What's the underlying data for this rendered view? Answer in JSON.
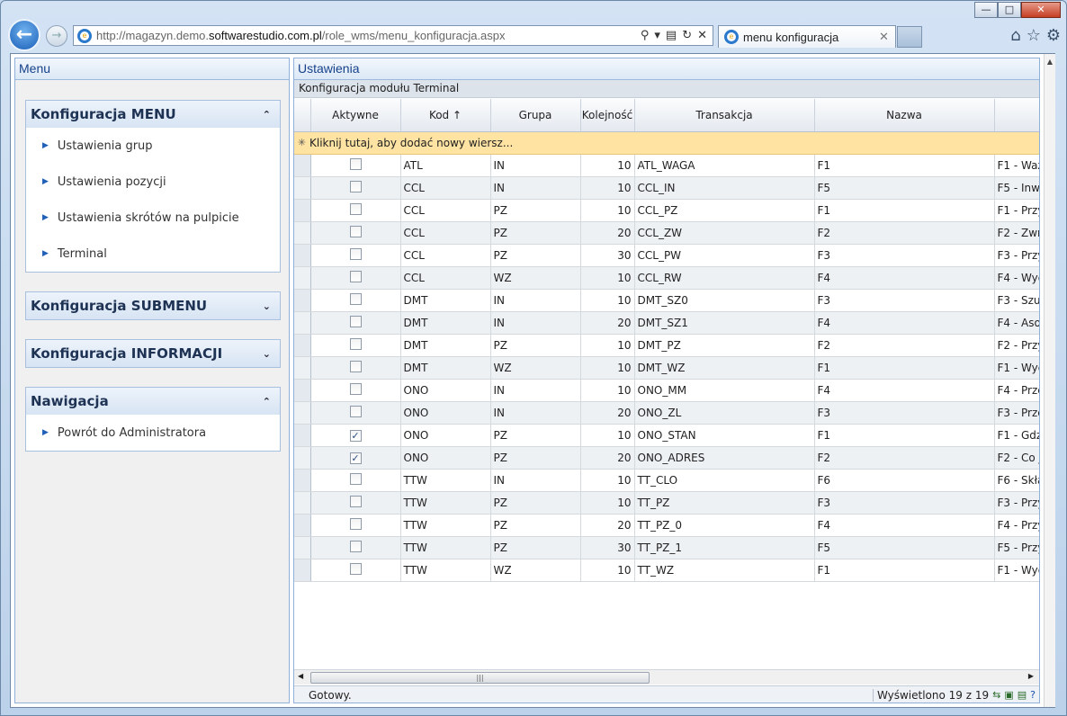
{
  "browser": {
    "url_pre": "http://magazyn.demo.",
    "url_domain": "softwarestudio.com.pl",
    "url_post": "/role_wms/menu_konfiguracja.aspx",
    "tab_title": "menu konfiguracja"
  },
  "left": {
    "title": "Menu",
    "sections": [
      {
        "title": "Konfiguracja MENU",
        "items": [
          "Ustawienia grup",
          "Ustawienia pozycji",
          "Ustawienia skrótów na pulpicie",
          "Terminal"
        ]
      },
      {
        "title": "Konfiguracja SUBMENU"
      },
      {
        "title": "Konfiguracja INFORMACJI"
      },
      {
        "title": "Nawigacja",
        "items": [
          "Powrót do Administratora"
        ]
      }
    ]
  },
  "right": {
    "title": "Ustawienia",
    "subtitle": "Konfiguracja modułu Terminal",
    "columns": [
      "Aktywne",
      "Kod",
      "Grupa",
      "Kolejność",
      "Transakcja",
      "Nazwa"
    ],
    "sort_arrow": "↑",
    "new_row": "Kliknij tutaj, aby dodać nowy wiersz...",
    "rows": [
      {
        "active": false,
        "kod": "ATL",
        "grupa": "IN",
        "kol": "10",
        "trans": "ATL_WAGA",
        "klawisz": "F1",
        "nazwa": "F1 - Waż"
      },
      {
        "active": false,
        "kod": "CCL",
        "grupa": "IN",
        "kol": "10",
        "trans": "CCL_IN",
        "klawisz": "F5",
        "nazwa": "F5 - Inw"
      },
      {
        "active": false,
        "kod": "CCL",
        "grupa": "PZ",
        "kol": "10",
        "trans": "CCL_PZ",
        "klawisz": "F1",
        "nazwa": "F1 - Przy"
      },
      {
        "active": false,
        "kod": "CCL",
        "grupa": "PZ",
        "kol": "20",
        "trans": "CCL_ZW",
        "klawisz": "F2",
        "nazwa": "F2 - Zwr"
      },
      {
        "active": false,
        "kod": "CCL",
        "grupa": "PZ",
        "kol": "30",
        "trans": "CCL_PW",
        "klawisz": "F3",
        "nazwa": "F3 - Przy"
      },
      {
        "active": false,
        "kod": "CCL",
        "grupa": "WZ",
        "kol": "10",
        "trans": "CCL_RW",
        "klawisz": "F4",
        "nazwa": "F4 - Wyd"
      },
      {
        "active": false,
        "kod": "DMT",
        "grupa": "IN",
        "kol": "10",
        "trans": "DMT_SZ0",
        "klawisz": "F3",
        "nazwa": "F3 - Szu"
      },
      {
        "active": false,
        "kod": "DMT",
        "grupa": "IN",
        "kol": "20",
        "trans": "DMT_SZ1",
        "klawisz": "F4",
        "nazwa": "F4 - Aso"
      },
      {
        "active": false,
        "kod": "DMT",
        "grupa": "PZ",
        "kol": "10",
        "trans": "DMT_PZ",
        "klawisz": "F2",
        "nazwa": "F2 - Przy"
      },
      {
        "active": false,
        "kod": "DMT",
        "grupa": "WZ",
        "kol": "10",
        "trans": "DMT_WZ",
        "klawisz": "F1",
        "nazwa": "F1 - Wyd"
      },
      {
        "active": false,
        "kod": "ONO",
        "grupa": "IN",
        "kol": "10",
        "trans": "ONO_MM",
        "klawisz": "F4",
        "nazwa": "F4 - Prze"
      },
      {
        "active": false,
        "kod": "ONO",
        "grupa": "IN",
        "kol": "20",
        "trans": "ONO_ZL",
        "klawisz": "F3",
        "nazwa": "F3 - Prze"
      },
      {
        "active": true,
        "kod": "ONO",
        "grupa": "PZ",
        "kol": "10",
        "trans": "ONO_STAN",
        "klawisz": "F1",
        "nazwa": "F1 - Gdz"
      },
      {
        "active": true,
        "kod": "ONO",
        "grupa": "PZ",
        "kol": "20",
        "trans": "ONO_ADRES",
        "klawisz": "F2",
        "nazwa": "F2 - Co j"
      },
      {
        "active": false,
        "kod": "TTW",
        "grupa": "IN",
        "kol": "10",
        "trans": "TT_CLO",
        "klawisz": "F6",
        "nazwa": "F6 - Skła"
      },
      {
        "active": false,
        "kod": "TTW",
        "grupa": "PZ",
        "kol": "10",
        "trans": "TT_PZ",
        "klawisz": "F3",
        "nazwa": "F3 - Przy"
      },
      {
        "active": false,
        "kod": "TTW",
        "grupa": "PZ",
        "kol": "20",
        "trans": "TT_PZ_0",
        "klawisz": "F4",
        "nazwa": "F4 - Przy"
      },
      {
        "active": false,
        "kod": "TTW",
        "grupa": "PZ",
        "kol": "30",
        "trans": "TT_PZ_1",
        "klawisz": "F5",
        "nazwa": "F5 - Przy"
      },
      {
        "active": false,
        "kod": "TTW",
        "grupa": "WZ",
        "kol": "10",
        "trans": "TT_WZ",
        "klawisz": "F1",
        "nazwa": "F1 - Wyd"
      }
    ],
    "status": "Gotowy.",
    "shown": "Wyświetlono 19 z 19"
  },
  "icons": {
    "back": "back-arrow-icon",
    "forward": "forward-arrow-icon",
    "home": "home-icon",
    "favorites": "star-icon",
    "tools": "gear-icon"
  }
}
